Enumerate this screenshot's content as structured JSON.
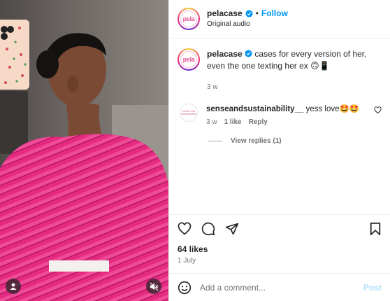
{
  "post": {
    "username": "pelacase",
    "avatar_label": "pela",
    "follow_label": "Follow",
    "separator": "•",
    "audio": "Original audio"
  },
  "caption": {
    "username": "pelacase",
    "text": "cases for every version of her, even the one texting her ex 🙃📱",
    "time": "3 w"
  },
  "comments": [
    {
      "username": "senseandsustainability__",
      "text": "yess love🤩🤩",
      "time": "3 w",
      "likes": "1 like",
      "reply_label": "Reply",
      "avatar_label": "sense and sustainability"
    }
  ],
  "view_replies": "View replies (1)",
  "likes": "64 likes",
  "date": "1 July",
  "add_comment": {
    "placeholder": "Add a comment...",
    "post_label": "Post"
  },
  "icons": {
    "verified": "verified-badge-icon",
    "like": "heart-icon",
    "comment": "comment-icon",
    "share": "send-icon",
    "save": "bookmark-icon",
    "emoji": "emoji-icon",
    "user_tag": "user-tag-icon",
    "mute": "muted-speaker-icon"
  },
  "colors": {
    "accent": "#0095f6",
    "post_disabled": "#b2dffc",
    "text": "#262626",
    "secondary": "#737373",
    "sweater": "#e8227e"
  }
}
